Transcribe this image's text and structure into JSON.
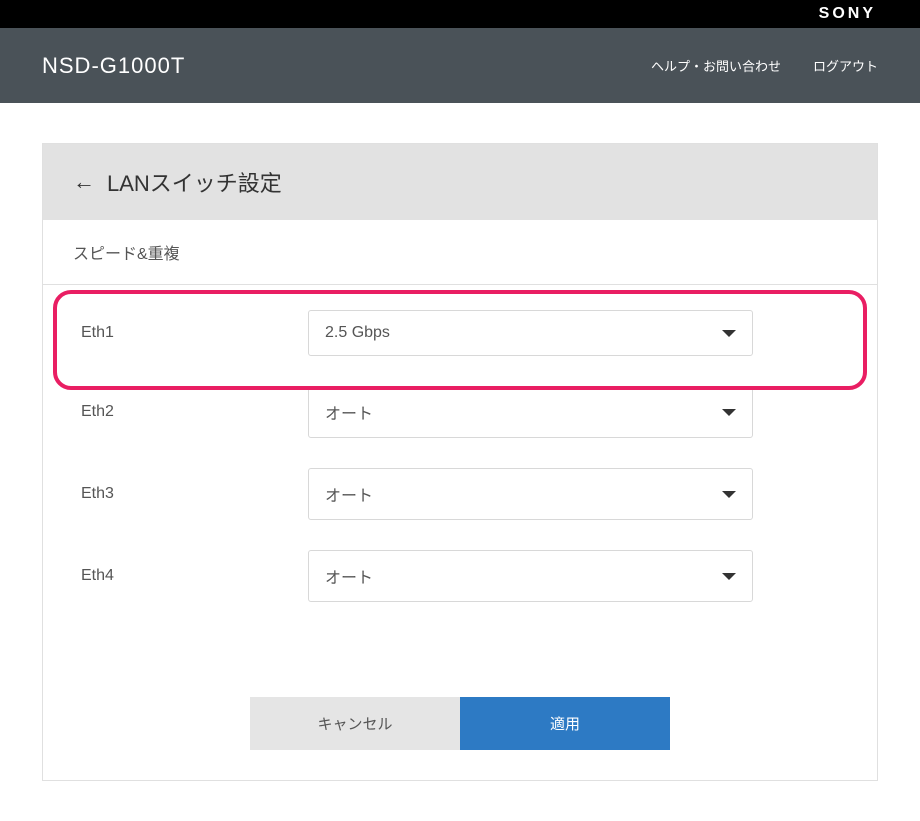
{
  "brand": "SONY",
  "model": "NSD-G1000T",
  "nav": {
    "help": "ヘルプ・お問い合わせ",
    "logout": "ログアウト"
  },
  "panel": {
    "title": "LANスイッチ設定",
    "section_title": "スピード&重複"
  },
  "rows": [
    {
      "label": "Eth1",
      "value": "2.5 Gbps"
    },
    {
      "label": "Eth2",
      "value": "オート"
    },
    {
      "label": "Eth3",
      "value": "オート"
    },
    {
      "label": "Eth4",
      "value": "オート"
    }
  ],
  "buttons": {
    "cancel": "キャンセル",
    "apply": "適用"
  }
}
